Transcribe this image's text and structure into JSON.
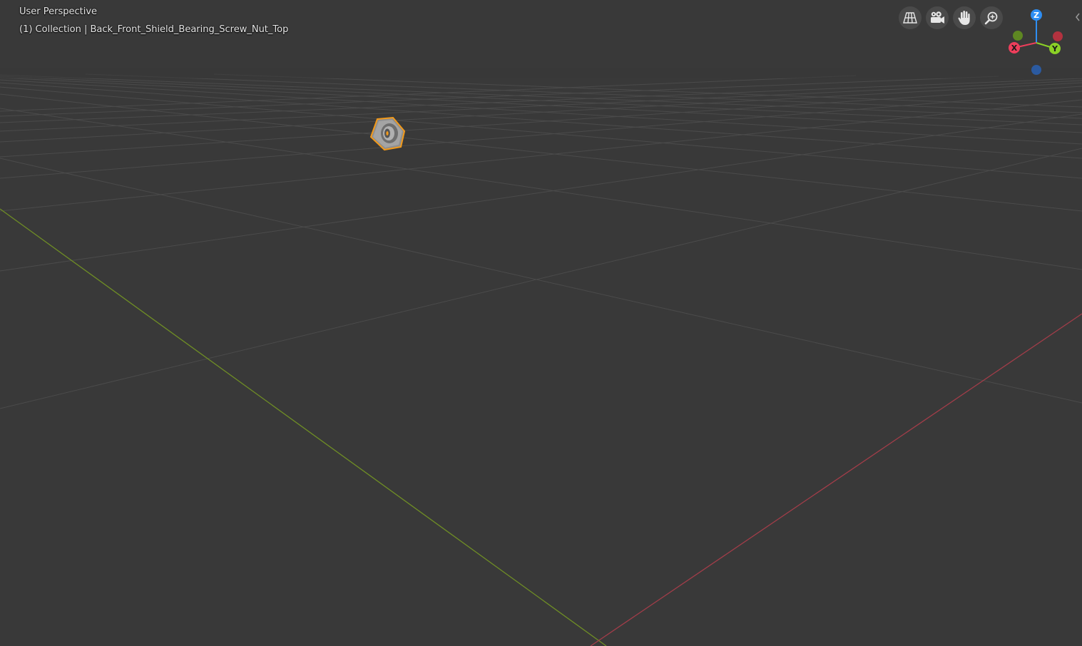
{
  "viewport": {
    "view_label": "User Perspective",
    "collection_prefix": "(1) Collection",
    "separator": " | ",
    "object_name": "Back_Front_Shield_Bearing_Screw_Nut_Top"
  },
  "nav_buttons": [
    {
      "icon": "grid-icon",
      "tooltip": ""
    },
    {
      "icon": "camera-icon",
      "tooltip": ""
    },
    {
      "icon": "hand-icon",
      "tooltip": ""
    },
    {
      "icon": "zoom-icon",
      "tooltip": ""
    }
  ],
  "gizmo": {
    "z_label": "Z",
    "y_label": "Y",
    "x_label": "X",
    "colors": {
      "x": "#ee3e5b",
      "y": "#8bd126",
      "z": "#2e8ef3",
      "neg_x": "#b2323f",
      "neg_y": "#5e8722",
      "neg_z": "#2b5aa0"
    }
  },
  "colors": {
    "background": "#393939",
    "grid_line": "#4a4a4a",
    "x_axis": "#9e3a45",
    "y_axis": "#6a8a24",
    "selection": "#f39a1a"
  }
}
